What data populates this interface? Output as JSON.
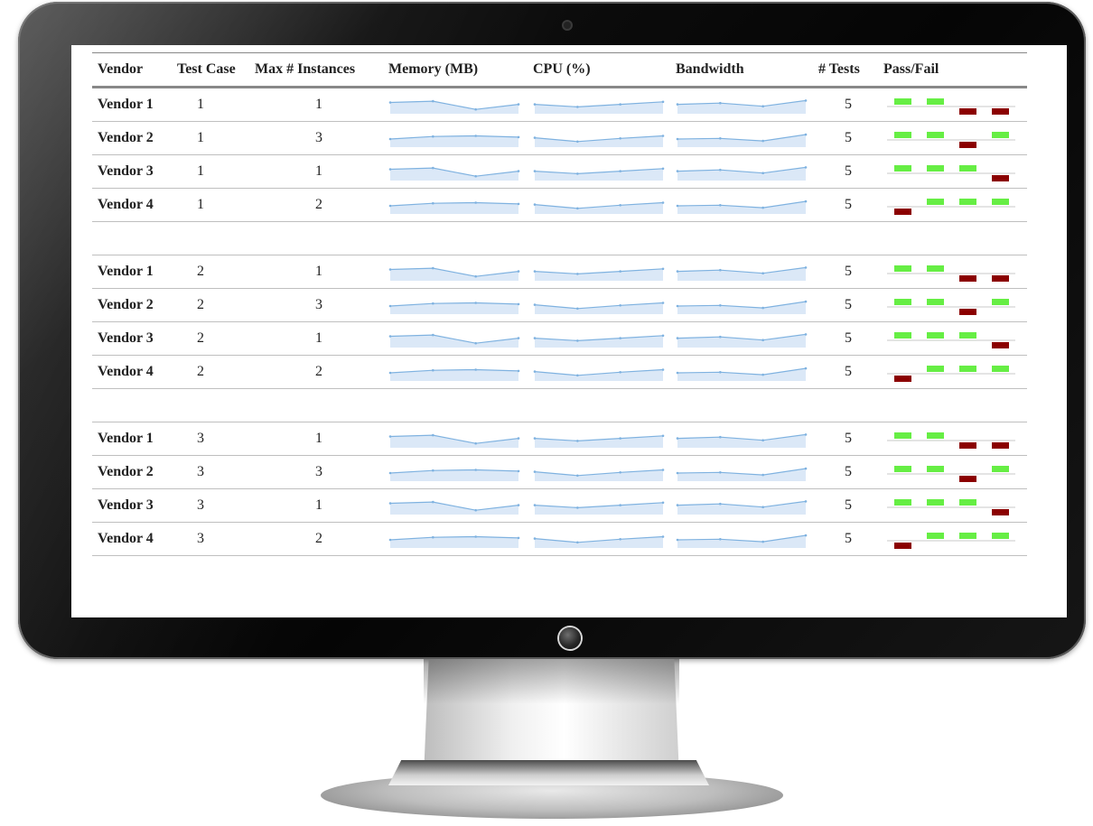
{
  "headers": {
    "vendor": "Vendor",
    "test_case": "Test Case",
    "max_instances": "Max # Instances",
    "memory": "Memory (MB)",
    "cpu": "CPU (%)",
    "bandwidth": "Bandwidth",
    "tests": "# Tests",
    "pass_fail": "Pass/Fail"
  },
  "colors": {
    "pass": "#66ee44",
    "fail": "#8b0000",
    "spark_fill": "#dbe8f7",
    "spark_line": "#7fb2e0"
  },
  "groups": [
    {
      "rows": [
        {
          "vendor": "Vendor 1",
          "test_case": "1",
          "max_instances": "1",
          "memory": [
            0.75,
            0.85,
            0.2,
            0.6
          ],
          "cpu": [
            0.6,
            0.4,
            0.6,
            0.8
          ],
          "bandwidth": [
            0.6,
            0.7,
            0.45,
            0.9
          ],
          "tests": "5",
          "pass_fail": [
            1,
            1,
            -1,
            -1
          ]
        },
        {
          "vendor": "Vendor 2",
          "test_case": "1",
          "max_instances": "3",
          "memory": [
            0.5,
            0.7,
            0.75,
            0.65
          ],
          "cpu": [
            0.6,
            0.3,
            0.55,
            0.75
          ],
          "bandwidth": [
            0.5,
            0.55,
            0.35,
            0.85
          ],
          "tests": "5",
          "pass_fail": [
            1,
            1,
            -1,
            1
          ]
        },
        {
          "vendor": "Vendor 3",
          "test_case": "1",
          "max_instances": "1",
          "memory": [
            0.75,
            0.85,
            0.2,
            0.6
          ],
          "cpu": [
            0.6,
            0.4,
            0.6,
            0.8
          ],
          "bandwidth": [
            0.6,
            0.7,
            0.45,
            0.9
          ],
          "tests": "5",
          "pass_fail": [
            1,
            1,
            1,
            -1
          ]
        },
        {
          "vendor": "Vendor 4",
          "test_case": "1",
          "max_instances": "2",
          "memory": [
            0.5,
            0.7,
            0.75,
            0.65
          ],
          "cpu": [
            0.6,
            0.3,
            0.55,
            0.75
          ],
          "bandwidth": [
            0.5,
            0.55,
            0.35,
            0.85
          ],
          "tests": "5",
          "pass_fail": [
            -1,
            1,
            1,
            1
          ]
        }
      ]
    },
    {
      "rows": [
        {
          "vendor": "Vendor 1",
          "test_case": "2",
          "max_instances": "1",
          "memory": [
            0.75,
            0.85,
            0.2,
            0.6
          ],
          "cpu": [
            0.6,
            0.4,
            0.6,
            0.8
          ],
          "bandwidth": [
            0.6,
            0.7,
            0.45,
            0.9
          ],
          "tests": "5",
          "pass_fail": [
            1,
            1,
            -1,
            -1
          ]
        },
        {
          "vendor": "Vendor 2",
          "test_case": "2",
          "max_instances": "3",
          "memory": [
            0.5,
            0.7,
            0.75,
            0.65
          ],
          "cpu": [
            0.6,
            0.3,
            0.55,
            0.75
          ],
          "bandwidth": [
            0.5,
            0.55,
            0.35,
            0.85
          ],
          "tests": "5",
          "pass_fail": [
            1,
            1,
            -1,
            1
          ]
        },
        {
          "vendor": "Vendor 3",
          "test_case": "2",
          "max_instances": "1",
          "memory": [
            0.75,
            0.85,
            0.2,
            0.6
          ],
          "cpu": [
            0.6,
            0.4,
            0.6,
            0.8
          ],
          "bandwidth": [
            0.6,
            0.7,
            0.45,
            0.9
          ],
          "tests": "5",
          "pass_fail": [
            1,
            1,
            1,
            -1
          ]
        },
        {
          "vendor": "Vendor 4",
          "test_case": "2",
          "max_instances": "2",
          "memory": [
            0.5,
            0.7,
            0.75,
            0.65
          ],
          "cpu": [
            0.6,
            0.3,
            0.55,
            0.75
          ],
          "bandwidth": [
            0.5,
            0.55,
            0.35,
            0.85
          ],
          "tests": "5",
          "pass_fail": [
            -1,
            1,
            1,
            1
          ]
        }
      ]
    },
    {
      "rows": [
        {
          "vendor": "Vendor 1",
          "test_case": "3",
          "max_instances": "1",
          "memory": [
            0.75,
            0.85,
            0.2,
            0.6
          ],
          "cpu": [
            0.6,
            0.4,
            0.6,
            0.8
          ],
          "bandwidth": [
            0.6,
            0.7,
            0.45,
            0.9
          ],
          "tests": "5",
          "pass_fail": [
            1,
            1,
            -1,
            -1
          ]
        },
        {
          "vendor": "Vendor 2",
          "test_case": "3",
          "max_instances": "3",
          "memory": [
            0.5,
            0.7,
            0.75,
            0.65
          ],
          "cpu": [
            0.6,
            0.3,
            0.55,
            0.75
          ],
          "bandwidth": [
            0.5,
            0.55,
            0.35,
            0.85
          ],
          "tests": "5",
          "pass_fail": [
            1,
            1,
            -1,
            1
          ]
        },
        {
          "vendor": "Vendor 3",
          "test_case": "3",
          "max_instances": "1",
          "memory": [
            0.75,
            0.85,
            0.2,
            0.6
          ],
          "cpu": [
            0.6,
            0.4,
            0.6,
            0.8
          ],
          "bandwidth": [
            0.6,
            0.7,
            0.45,
            0.9
          ],
          "tests": "5",
          "pass_fail": [
            1,
            1,
            1,
            -1
          ]
        },
        {
          "vendor": "Vendor 4",
          "test_case": "3",
          "max_instances": "2",
          "memory": [
            0.5,
            0.7,
            0.75,
            0.65
          ],
          "cpu": [
            0.6,
            0.3,
            0.55,
            0.75
          ],
          "bandwidth": [
            0.5,
            0.55,
            0.35,
            0.85
          ],
          "tests": "5",
          "pass_fail": [
            -1,
            1,
            1,
            1
          ]
        }
      ]
    }
  ]
}
